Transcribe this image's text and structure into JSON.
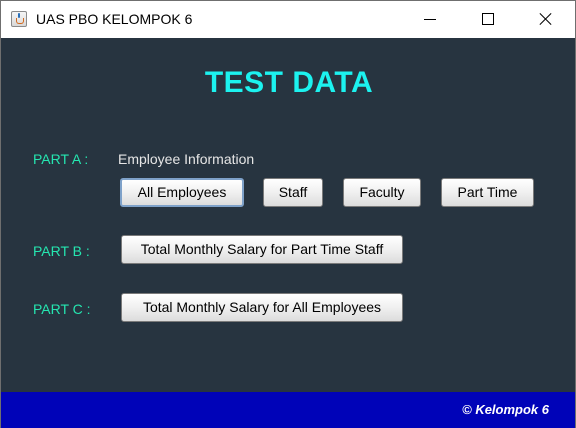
{
  "window": {
    "title": "UAS PBO KELOMPOK 6",
    "icon": "java-cup-icon",
    "controls": [
      "minimize-icon",
      "maximize-icon",
      "close-icon"
    ]
  },
  "main": {
    "heading": "TEST DATA",
    "part_a": {
      "label": "PART A :",
      "subtitle": "Employee Information",
      "buttons": [
        "All Employees",
        "Staff",
        "Faculty",
        "Part Time"
      ]
    },
    "part_b": {
      "label": "PART B :",
      "button": "Total Monthly Salary for Part Time Staff"
    },
    "part_c": {
      "label": "PART C :",
      "button": "Total Monthly Salary for All Employees"
    }
  },
  "footer": {
    "credit": "© Kelompok 6"
  },
  "colors": {
    "background": "#273440",
    "heading": "#1cf2ef",
    "part_label": "#25e6b0",
    "footer": "#0003b8"
  }
}
